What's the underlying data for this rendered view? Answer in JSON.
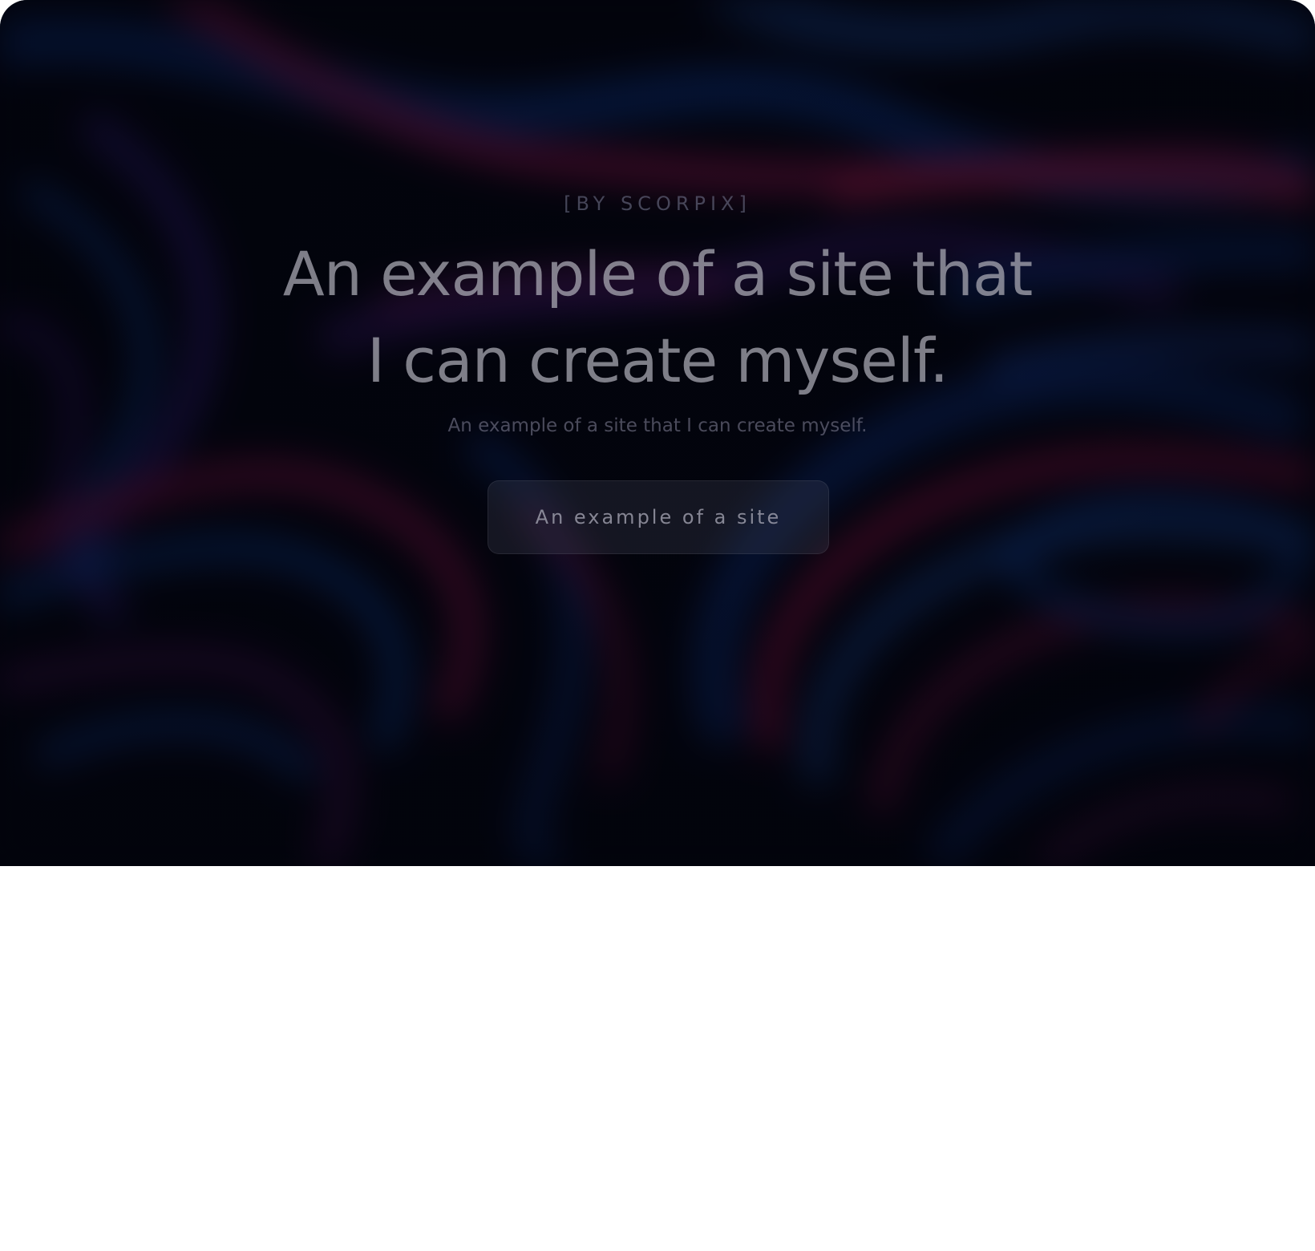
{
  "hero": {
    "eyebrow": "[BY SCORPIX]",
    "headline_line1": "An example of a site that",
    "headline_line2": "I can create myself.",
    "subheadline": "An example of a site that I can create myself.",
    "cta_label": "An example of a site"
  },
  "colors": {
    "background": "#03040d",
    "accent_pink": "#a0124a",
    "accent_blue": "#0b2f78",
    "accent_purple": "#3b1a6e",
    "page_below": "#ffffff"
  }
}
